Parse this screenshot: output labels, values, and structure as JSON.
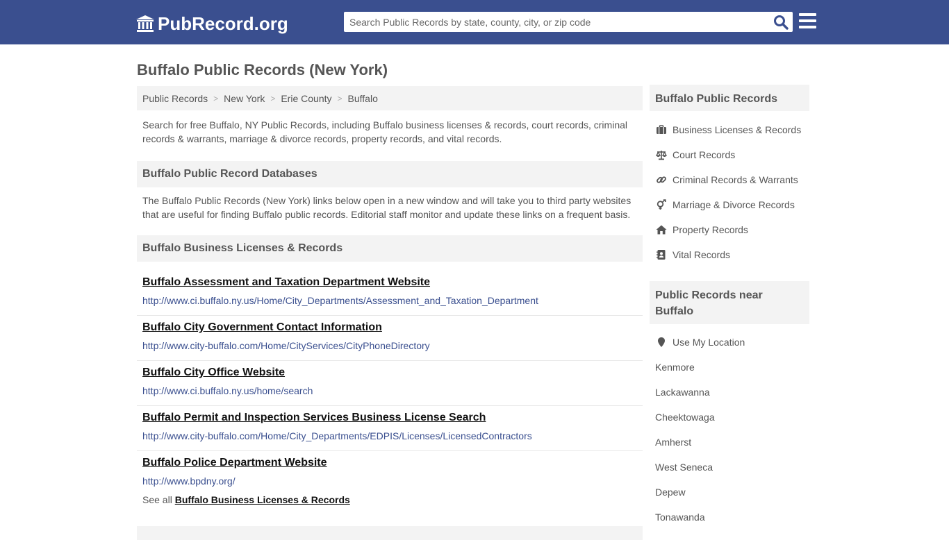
{
  "header": {
    "logo_text": "PubRecord.org",
    "search_placeholder": "Search Public Records by state, county, city, or zip code",
    "brand_color": "#3a4f8f"
  },
  "page_title": "Buffalo Public Records (New York)",
  "breadcrumb": [
    "Public Records",
    "New York",
    "Erie County",
    "Buffalo"
  ],
  "intro": "Search for free Buffalo, NY Public Records, including Buffalo business licenses & records, court records, criminal records & warrants, marriage & divorce records, property records, and vital records.",
  "databases": {
    "heading": "Buffalo Public Record Databases",
    "description": "The Buffalo Public Records (New York) links below open in a new window and will take you to third party websites that are useful for finding Buffalo public records. Editorial staff monitor and update these links on a frequent basis."
  },
  "business": {
    "heading": "Buffalo Business Licenses & Records",
    "links": [
      {
        "title": "Buffalo Assessment and Taxation Department Website",
        "url": "http://www.ci.buffalo.ny.us/Home/City_Departments/Assessment_and_Taxation_Department"
      },
      {
        "title": "Buffalo City Government Contact Information",
        "url": "http://www.city-buffalo.com/Home/CityServices/CityPhoneDirectory"
      },
      {
        "title": "Buffalo City Office Website",
        "url": "http://www.ci.buffalo.ny.us/home/search"
      },
      {
        "title": "Buffalo Permit and Inspection Services Business License Search",
        "url": "http://www.city-buffalo.com/Home/City_Departments/EDPIS/Licenses/LicensedContractors"
      },
      {
        "title": "Buffalo Police Department Website",
        "url": "http://www.bpdny.org/"
      }
    ],
    "see_all_prefix": "See all",
    "see_all_link": "Buffalo Business Licenses & Records"
  },
  "sidebar": {
    "records_heading": "Buffalo Public Records",
    "records": [
      {
        "label": "Business Licenses & Records",
        "icon": "briefcase-icon"
      },
      {
        "label": "Court Records",
        "icon": "scales-icon"
      },
      {
        "label": "Criminal Records & Warrants",
        "icon": "link-icon"
      },
      {
        "label": "Marriage & Divorce Records",
        "icon": "gender-icon"
      },
      {
        "label": "Property Records",
        "icon": "home-icon"
      },
      {
        "label": "Vital Records",
        "icon": "address-book-icon"
      }
    ],
    "near_heading": "Public Records near Buffalo",
    "use_location": "Use My Location",
    "nearby": [
      "Kenmore",
      "Lackawanna",
      "Cheektowaga",
      "Amherst",
      "West Seneca",
      "Depew",
      "Tonawanda"
    ]
  }
}
